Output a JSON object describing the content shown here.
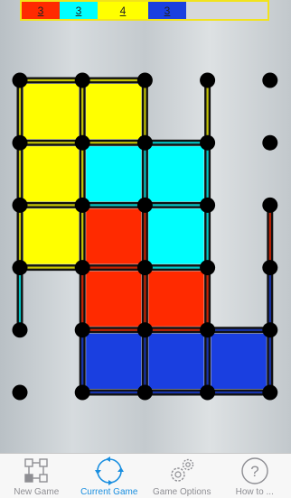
{
  "scoreboard": {
    "red": "3",
    "cyan": "3",
    "yellow": "4",
    "blue": "3"
  },
  "colors": {
    "red": "#ff2a00",
    "cyan": "#00ffff",
    "yellow": "#ffff00",
    "blue": "#1a3fe0",
    "dot": "#000000",
    "active_tab": "#1a8fe0"
  },
  "grid": {
    "cols": 5,
    "rows": 6,
    "boxes": [
      {
        "col": 0,
        "row": 0,
        "owner": "yellow"
      },
      {
        "col": 1,
        "row": 0,
        "owner": "yellow"
      },
      {
        "col": 0,
        "row": 1,
        "owner": "yellow"
      },
      {
        "col": 1,
        "row": 1,
        "owner": "cyan"
      },
      {
        "col": 2,
        "row": 1,
        "owner": "cyan"
      },
      {
        "col": 0,
        "row": 2,
        "owner": "yellow"
      },
      {
        "col": 1,
        "row": 2,
        "owner": "red"
      },
      {
        "col": 2,
        "row": 2,
        "owner": "cyan"
      },
      {
        "col": 1,
        "row": 3,
        "owner": "red"
      },
      {
        "col": 2,
        "row": 3,
        "owner": "red"
      },
      {
        "col": 1,
        "row": 4,
        "owner": "blue"
      },
      {
        "col": 2,
        "row": 4,
        "owner": "blue"
      },
      {
        "col": 3,
        "row": 4,
        "owner": "blue"
      }
    ],
    "extra_lines": [
      {
        "from": [
          3,
          0
        ],
        "to": [
          3,
          1
        ],
        "owner": "yellow"
      },
      {
        "from": [
          4,
          2
        ],
        "to": [
          4,
          3
        ],
        "owner": "red"
      },
      {
        "from": [
          4,
          3
        ],
        "to": [
          4,
          4
        ],
        "owner": "blue"
      },
      {
        "from": [
          0,
          3
        ],
        "to": [
          0,
          4
        ],
        "owner": "cyan"
      }
    ]
  },
  "tabs": [
    {
      "label": "New Game",
      "icon": "new-game-icon"
    },
    {
      "label": "Current Game",
      "icon": "refresh-icon"
    },
    {
      "label": "Game Options",
      "icon": "gears-icon"
    },
    {
      "label": "How to ...",
      "icon": "question-icon"
    }
  ]
}
